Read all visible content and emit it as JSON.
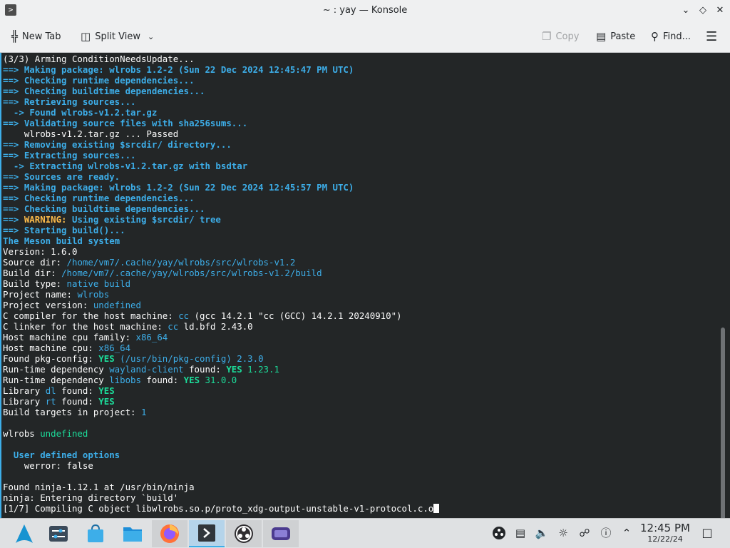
{
  "window": {
    "title": "~ : yay — Konsole",
    "app_icon": "konsole-icon"
  },
  "toolbar": {
    "new_tab": "New Tab",
    "split_view": "Split View",
    "copy": "Copy",
    "paste": "Paste",
    "find": "Find..."
  },
  "terminal": {
    "lines": [
      [
        {
          "t": "(3/3) Arming ConditionNeedsUpdate...",
          "c": ""
        }
      ],
      [
        {
          "t": "==> ",
          "c": "arrow"
        },
        {
          "t": "Making package: wlrobs 1.2-2 (Sun 22 Dec 2024 12:45:47 PM UTC)",
          "c": "blue"
        }
      ],
      [
        {
          "t": "==> ",
          "c": "arrow"
        },
        {
          "t": "Checking runtime dependencies...",
          "c": "blue"
        }
      ],
      [
        {
          "t": "==> ",
          "c": "arrow"
        },
        {
          "t": "Checking buildtime dependencies...",
          "c": "blue"
        }
      ],
      [
        {
          "t": "==> ",
          "c": "arrow"
        },
        {
          "t": "Retrieving sources...",
          "c": "blue"
        }
      ],
      [
        {
          "t": "  -> ",
          "c": "arrow"
        },
        {
          "t": "Found wlrobs-v1.2.tar.gz",
          "c": "blue"
        }
      ],
      [
        {
          "t": "==> ",
          "c": "arrow"
        },
        {
          "t": "Validating source files with sha256sums...",
          "c": "blue"
        }
      ],
      [
        {
          "t": "    wlrobs-v1.2.tar.gz ... Passed",
          "c": ""
        }
      ],
      [
        {
          "t": "==> ",
          "c": "arrow"
        },
        {
          "t": "Removing existing $srcdir/ directory...",
          "c": "blue"
        }
      ],
      [
        {
          "t": "==> ",
          "c": "arrow"
        },
        {
          "t": "Extracting sources...",
          "c": "blue"
        }
      ],
      [
        {
          "t": "  -> ",
          "c": "arrow"
        },
        {
          "t": "Extracting wlrobs-v1.2.tar.gz with bsdtar",
          "c": "blue"
        }
      ],
      [
        {
          "t": "==> ",
          "c": "arrow"
        },
        {
          "t": "Sources are ready.",
          "c": "blue"
        }
      ],
      [
        {
          "t": "==> ",
          "c": "arrow"
        },
        {
          "t": "Making package: wlrobs 1.2-2 (Sun 22 Dec 2024 12:45:57 PM UTC)",
          "c": "blue"
        }
      ],
      [
        {
          "t": "==> ",
          "c": "arrow"
        },
        {
          "t": "Checking runtime dependencies...",
          "c": "blue"
        }
      ],
      [
        {
          "t": "==> ",
          "c": "arrow"
        },
        {
          "t": "Checking buildtime dependencies...",
          "c": "blue"
        }
      ],
      [
        {
          "t": "==> ",
          "c": "arrow"
        },
        {
          "t": "WARNING: ",
          "c": "yellow"
        },
        {
          "t": "Using existing $srcdir/ tree",
          "c": "blue"
        }
      ],
      [
        {
          "t": "==> ",
          "c": "arrow"
        },
        {
          "t": "Starting build()...",
          "c": "blue"
        }
      ],
      [
        {
          "t": "The Meson build system",
          "c": "blue"
        }
      ],
      [
        {
          "t": "Version: 1.6.0",
          "c": ""
        }
      ],
      [
        {
          "t": "Source dir: ",
          "c": ""
        },
        {
          "t": "/home/vm7/.cache/yay/wlrobs/src/wlrobs-v1.2",
          "c": "link"
        }
      ],
      [
        {
          "t": "Build dir: ",
          "c": ""
        },
        {
          "t": "/home/vm7/.cache/yay/wlrobs/src/wlrobs-v1.2/build",
          "c": "link"
        }
      ],
      [
        {
          "t": "Build type: ",
          "c": ""
        },
        {
          "t": "native build",
          "c": "link"
        }
      ],
      [
        {
          "t": "Project name: ",
          "c": ""
        },
        {
          "t": "wlrobs",
          "c": "link"
        }
      ],
      [
        {
          "t": "Project version: ",
          "c": ""
        },
        {
          "t": "undefined",
          "c": "link"
        }
      ],
      [
        {
          "t": "C compiler for the host machine: ",
          "c": ""
        },
        {
          "t": "cc",
          "c": "link"
        },
        {
          "t": " (gcc 14.2.1 \"cc (GCC) 14.2.1 20240910\")",
          "c": ""
        }
      ],
      [
        {
          "t": "C linker for the host machine: ",
          "c": ""
        },
        {
          "t": "cc",
          "c": "link"
        },
        {
          "t": " ld.bfd 2.43.0",
          "c": ""
        }
      ],
      [
        {
          "t": "Host machine cpu family: ",
          "c": ""
        },
        {
          "t": "x86_64",
          "c": "link"
        }
      ],
      [
        {
          "t": "Host machine cpu: ",
          "c": ""
        },
        {
          "t": "x86_64",
          "c": "link"
        }
      ],
      [
        {
          "t": "Found pkg-config: ",
          "c": ""
        },
        {
          "t": "YES",
          "c": "green"
        },
        {
          "t": " (/usr/bin/pkg-config) 2.3.0",
          "c": "link"
        }
      ],
      [
        {
          "t": "Run-time dependency ",
          "c": ""
        },
        {
          "t": "wayland-client",
          "c": "link"
        },
        {
          "t": " found: ",
          "c": ""
        },
        {
          "t": "YES",
          "c": "green"
        },
        {
          "t": " 1.23.1",
          "c": "greenn"
        }
      ],
      [
        {
          "t": "Run-time dependency ",
          "c": ""
        },
        {
          "t": "libobs",
          "c": "link"
        },
        {
          "t": " found: ",
          "c": ""
        },
        {
          "t": "YES",
          "c": "green"
        },
        {
          "t": " 31.0.0",
          "c": "greenn"
        }
      ],
      [
        {
          "t": "Library ",
          "c": ""
        },
        {
          "t": "dl",
          "c": "link"
        },
        {
          "t": " found: ",
          "c": ""
        },
        {
          "t": "YES",
          "c": "green"
        }
      ],
      [
        {
          "t": "Library ",
          "c": ""
        },
        {
          "t": "rt",
          "c": "link"
        },
        {
          "t": " found: ",
          "c": ""
        },
        {
          "t": "YES",
          "c": "green"
        }
      ],
      [
        {
          "t": "Build targets in project: ",
          "c": ""
        },
        {
          "t": "1",
          "c": "link"
        }
      ],
      [
        {
          "t": "",
          "c": ""
        }
      ],
      [
        {
          "t": "wlrobs ",
          "c": ""
        },
        {
          "t": "undefined",
          "c": "greenn"
        }
      ],
      [
        {
          "t": "",
          "c": ""
        }
      ],
      [
        {
          "t": "  User defined options",
          "c": "blue"
        }
      ],
      [
        {
          "t": "    werror: false",
          "c": ""
        }
      ],
      [
        {
          "t": "",
          "c": ""
        }
      ],
      [
        {
          "t": "Found ninja-1.12.1 at /usr/bin/ninja",
          "c": ""
        }
      ],
      [
        {
          "t": "ninja: Entering directory `build'",
          "c": ""
        }
      ],
      [
        {
          "t": "[1/7] Compiling C object libwlrobs.so.p/proto_xdg-output-unstable-v1-protocol.c.o",
          "c": ""
        }
      ]
    ]
  },
  "taskbar": {
    "clock_time": "12:45 PM",
    "clock_date": "12/22/24"
  },
  "colors": {
    "terminal_bg": "#232627",
    "accent_blue": "#3daee9",
    "warning_yellow": "#fdbc4b",
    "success_green": "#1cdc9a",
    "text": "#fcfcfc"
  }
}
